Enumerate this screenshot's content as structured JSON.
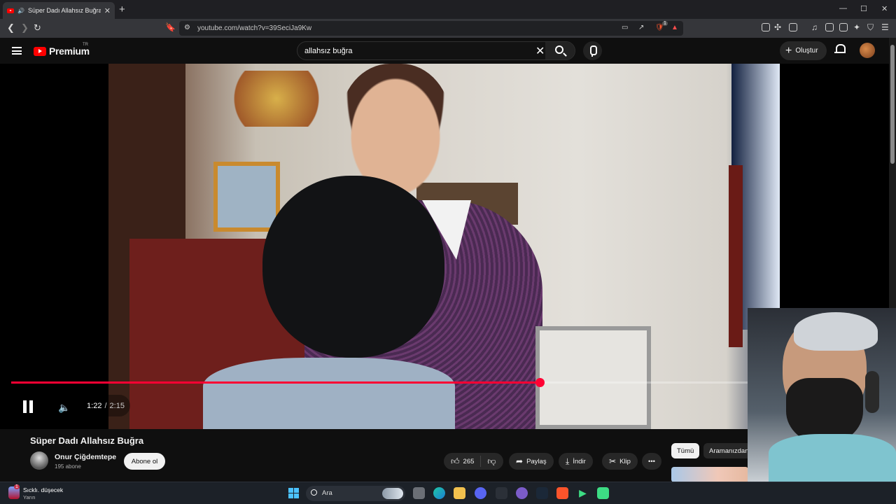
{
  "browser": {
    "tab_title": "Süper Dadı Allahsız Buğra - Yo",
    "new_tab_icon": "+",
    "window_controls": [
      "—",
      "☐",
      "✕"
    ],
    "url": "youtube.com/watch?v=39SeciJa9Kw",
    "extension_badge": "1"
  },
  "masthead": {
    "brand": "Premium",
    "country_code": "TR",
    "search_query": "allahsız buğra",
    "create_label": "Oluştur"
  },
  "player": {
    "time_current": "1:22",
    "time_total": "2:15",
    "time_display": "1:22 / 2:15",
    "progress_fraction": 0.6087,
    "accent_color": "#ff0033"
  },
  "video": {
    "title": "Süper Dadı Allahsız Buğra",
    "channel_name": "Onur Çiğdemtepe",
    "channel_subs": "195 abone",
    "subscribe_label": "Abone ol",
    "likes": "265",
    "share_label": "Paylaş",
    "download_label": "İndir",
    "clip_label": "Klip"
  },
  "related": {
    "chips": [
      "Tümü",
      "Aramanızdan"
    ]
  },
  "taskbar": {
    "weather_title": "Sıcklı. düşecek",
    "weather_sub": "Yarın",
    "weather_badge": "1",
    "search_placeholder": "Ara"
  }
}
